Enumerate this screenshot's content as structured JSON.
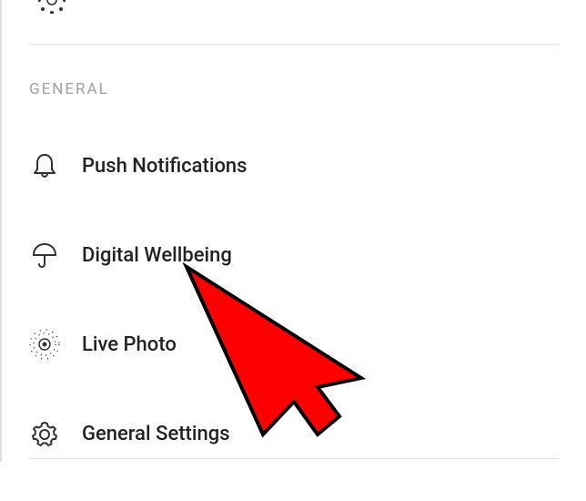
{
  "section_header": "GENERAL",
  "menu": {
    "push_notifications": {
      "label": "Push Notifications",
      "icon": "bell"
    },
    "digital_wellbeing": {
      "label": "Digital Wellbeing",
      "icon": "umbrella"
    },
    "live_photo": {
      "label": "Live Photo",
      "icon": "live-photo"
    },
    "general_settings": {
      "label": "General Settings",
      "icon": "gear"
    }
  },
  "annotation": {
    "type": "arrow-cursor",
    "color": "#ff0000",
    "points_to": "digital_wellbeing"
  }
}
